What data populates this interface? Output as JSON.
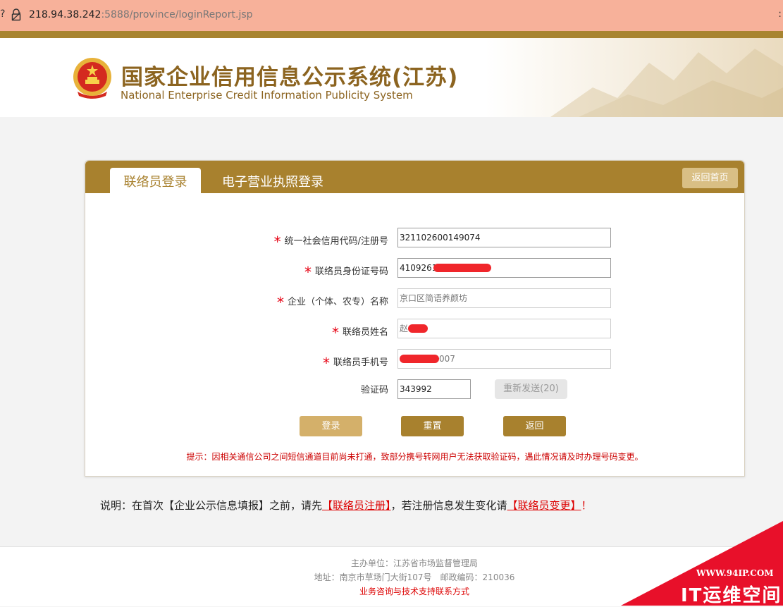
{
  "browser": {
    "url_host": "218.94.38.242",
    "url_rest": ":5888/province/loginReport.jsp"
  },
  "header": {
    "title": "国家企业信用信息公示系统(江苏)",
    "subtitle": "National Enterprise Credit Information Publicity System"
  },
  "tabs": {
    "active": "联络员登录",
    "inactive": "电子营业执照登录"
  },
  "home_button": "返回首页",
  "form": {
    "credit_code_label": "统一社会信用代码/注册号",
    "credit_code_value": "321102600149074",
    "id_label": "联络员身份证号码",
    "id_value": "4109261",
    "company_label": "企业（个体、农专）名称",
    "company_value": "京口区简语养颜坊",
    "name_label": "联络员姓名",
    "name_value": "赵",
    "phone_label": "联络员手机号",
    "phone_value": "007",
    "code_label": "验证码",
    "code_value": "343992",
    "resend_label": "重新发送(20)"
  },
  "buttons": {
    "login": "登录",
    "reset": "重置",
    "back": "返回"
  },
  "tip": "提示：因相关通信公司之间短信通道目前尚未打通，致部分携号转网用户无法获取验证码，遇此情况请及时办理号码变更。",
  "note": {
    "prefix": "说明：在首次【企业公示信息填报】之前，请先",
    "register_link": "【联络员注册】",
    "middle": "，若注册信息发生变化请",
    "change_link": "【联络员变更】",
    "suffix": "！"
  },
  "footer": {
    "sponsor": "主办单位：江苏省市场监督管理局",
    "address": "地址：南京市草场门大街107号　邮政编码：210036",
    "contact": "业务咨询与技术支持联系方式"
  },
  "watermark": {
    "url": "WWW.94IP.COM",
    "brand": "IT运维空间"
  },
  "colors": {
    "brand_gold": "#a8812e",
    "alert_red": "#e60012",
    "url_bar": "#f7b19a"
  }
}
